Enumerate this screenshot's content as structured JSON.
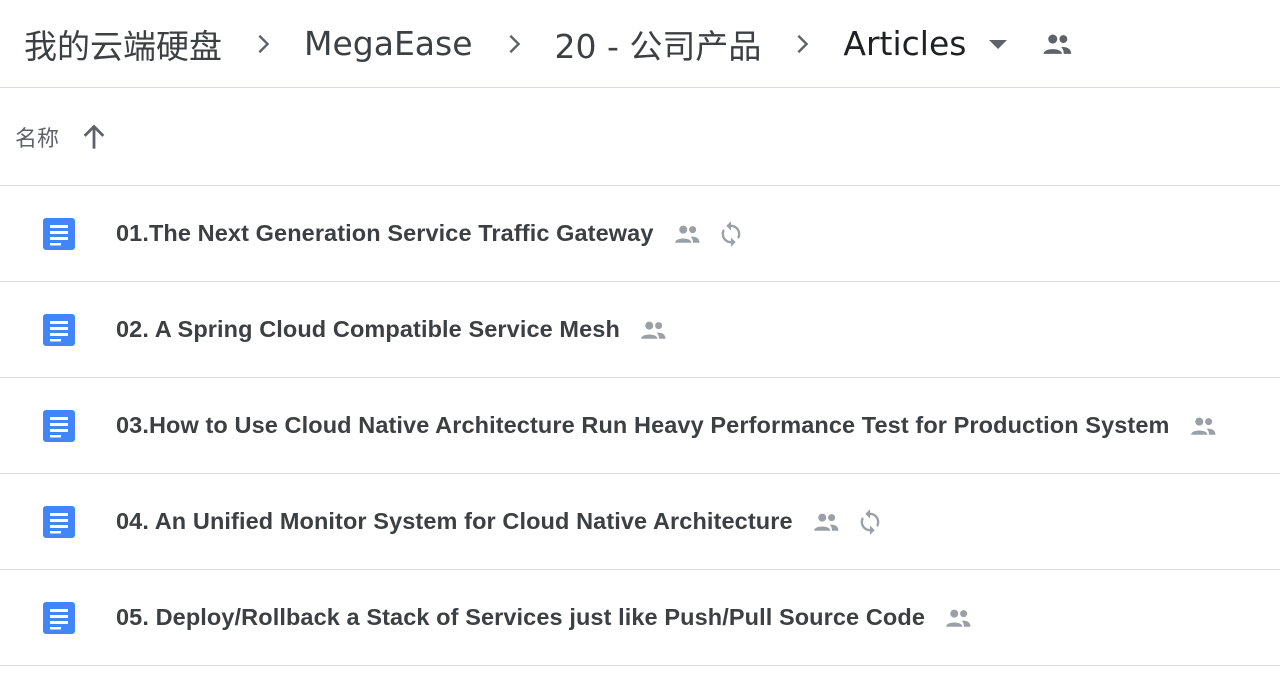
{
  "breadcrumb": {
    "items": [
      "我的云端硬盘",
      "MegaEase",
      "20 - 公司产品"
    ],
    "current": "Articles"
  },
  "list_header": {
    "name_label": "名称",
    "sort_icon": "arrow-up-icon"
  },
  "files": [
    {
      "name": "01.The Next Generation Service Traffic Gateway",
      "shared": true,
      "syncing": true,
      "icon": "google-docs-icon"
    },
    {
      "name": "02. A Spring Cloud Compatible Service Mesh",
      "shared": true,
      "syncing": false,
      "icon": "google-docs-icon"
    },
    {
      "name": "03.How to Use Cloud Native Architecture Run Heavy Performance Test  for Production System",
      "shared": true,
      "syncing": false,
      "icon": "google-docs-icon"
    },
    {
      "name": "04. An Unified Monitor System for Cloud Native Architecture",
      "shared": true,
      "syncing": true,
      "icon": "google-docs-icon"
    },
    {
      "name": "05. Deploy/Rollback a Stack of Services just like Push/Pull Source Code",
      "shared": true,
      "syncing": false,
      "icon": "google-docs-icon"
    }
  ],
  "colors": {
    "doc_icon": "#4285f4",
    "meta_icon": "#9aa0a6",
    "divider": "#dadce0",
    "text": "#3c4043"
  }
}
